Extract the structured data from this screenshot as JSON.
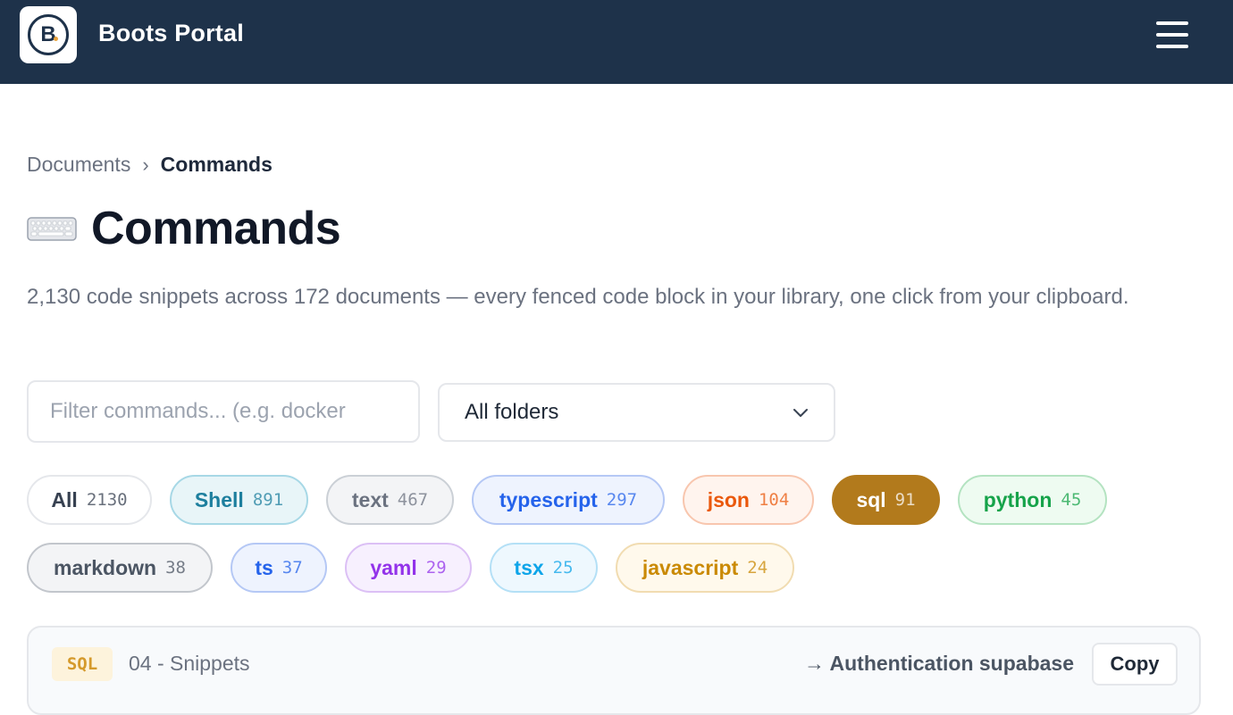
{
  "header": {
    "logo_letter": "B",
    "app_title": "Boots Portal",
    "menu_icon": "hamburger-menu-icon"
  },
  "breadcrumb": {
    "parent": "Documents",
    "separator": "›",
    "current": "Commands"
  },
  "page": {
    "title_icon": "keyboard-icon",
    "title": "Commands",
    "subtitle": "2,130 code snippets across 172 documents — every fenced code block in your library, one click from your clipboard."
  },
  "filters": {
    "search_placeholder": "Filter commands... (e.g. docker",
    "search_value": "",
    "folder_selected": "All folders"
  },
  "chips": [
    {
      "label": "All",
      "count": "2130",
      "text_color": "#374151",
      "bg": "#ffffff",
      "border": "#e5e7eb"
    },
    {
      "label": "Shell",
      "count": "891",
      "text_color": "#1d7f9e",
      "bg": "#e8f5f8",
      "border": "#a7d8e6"
    },
    {
      "label": "text",
      "count": "467",
      "text_color": "#6b7280",
      "bg": "#f3f4f6",
      "border": "#cbd0d6"
    },
    {
      "label": "typescript",
      "count": "297",
      "text_color": "#2563eb",
      "bg": "#eef3fe",
      "border": "#b5c8f5"
    },
    {
      "label": "json",
      "count": "104",
      "text_color": "#ea580c",
      "bg": "#fff4ee",
      "border": "#f8c6ae"
    },
    {
      "label": "sql",
      "count": "91",
      "text_color": "#ffffff",
      "bg": "#b27a1c",
      "border": "#b27a1c"
    },
    {
      "label": "python",
      "count": "45",
      "text_color": "#16a34a",
      "bg": "#eefbf1",
      "border": "#b4e3c1"
    },
    {
      "label": "markdown",
      "count": "38",
      "text_color": "#4b5563",
      "bg": "#f3f4f6",
      "border": "#c2c6cc"
    },
    {
      "label": "ts",
      "count": "37",
      "text_color": "#2563eb",
      "bg": "#eef3fe",
      "border": "#b5c8f5"
    },
    {
      "label": "yaml",
      "count": "29",
      "text_color": "#9333ea",
      "bg": "#f7f0fe",
      "border": "#dcc0f5"
    },
    {
      "label": "tsx",
      "count": "25",
      "text_color": "#0ea5e9",
      "bg": "#eef8fe",
      "border": "#b4e0f6"
    },
    {
      "label": "javascript",
      "count": "24",
      "text_color": "#ca8a04",
      "bg": "#fff9ec",
      "border": "#f1dcb1"
    }
  ],
  "snippet": {
    "lang": "SQL",
    "folder": "04 - Snippets",
    "doc_link": "→ Authentication supabase",
    "copy_label": "Copy"
  }
}
